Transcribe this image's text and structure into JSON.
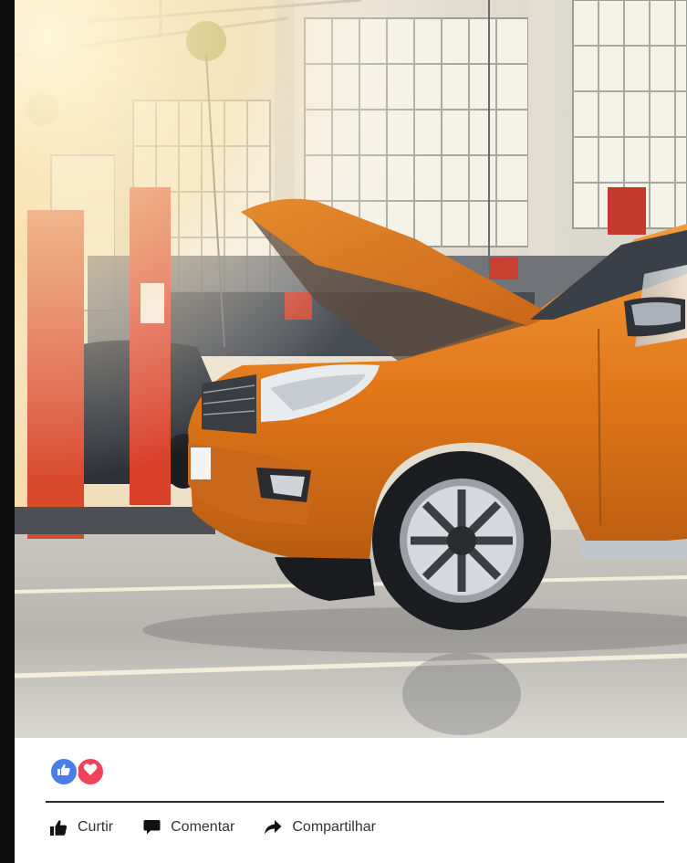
{
  "post": {
    "image_alt": "Orange pickup truck with open hood in a car repair garage",
    "reactions": [
      {
        "type": "like",
        "icon": "thumbs-up-icon",
        "color": "#4a7de8"
      },
      {
        "type": "love",
        "icon": "heart-icon",
        "color": "#f0435b"
      }
    ],
    "actions": {
      "like_label": "Curtir",
      "comment_label": "Comentar",
      "share_label": "Compartilhar"
    }
  },
  "colors": {
    "truck_orange": "#e37a1b",
    "lift_red": "#d8402a",
    "text": "#333333"
  }
}
